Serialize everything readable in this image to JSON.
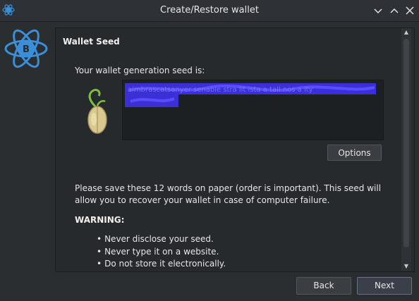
{
  "window": {
    "title": "Create/Restore wallet",
    "icon": "electrum-bitcoin-icon",
    "controls": [
      "minimize-icon",
      "maximize-icon",
      "close-icon"
    ]
  },
  "logo": {
    "icon": "electrum-bitcoin-logo",
    "color": "#3a8fd8"
  },
  "panel": {
    "heading": "Wallet Seed",
    "seed_label": "Your wallet generation seed is:",
    "seed_icon": "sprouting-seed-icon",
    "seed_text_state": "redacted",
    "options_label": "Options",
    "message": "Please save these 12 words on paper (order is important). This seed will allow you to recover your wallet in case of computer failure.",
    "warning_title": "WARNING:",
    "warnings": [
      "Never disclose your seed.",
      "Never type it on a website.",
      "Do not store it electronically."
    ]
  },
  "scrollbar": {
    "up_icon": "scroll-up-arrow-icon",
    "down_icon": "scroll-down-arrow-icon"
  },
  "footer": {
    "back_label": "Back",
    "next_label": "Next"
  },
  "colors": {
    "background": "#2b2e31",
    "panel": "#272a2d",
    "redaction": "#3b2fd6",
    "accent": "#3a8fd8"
  }
}
